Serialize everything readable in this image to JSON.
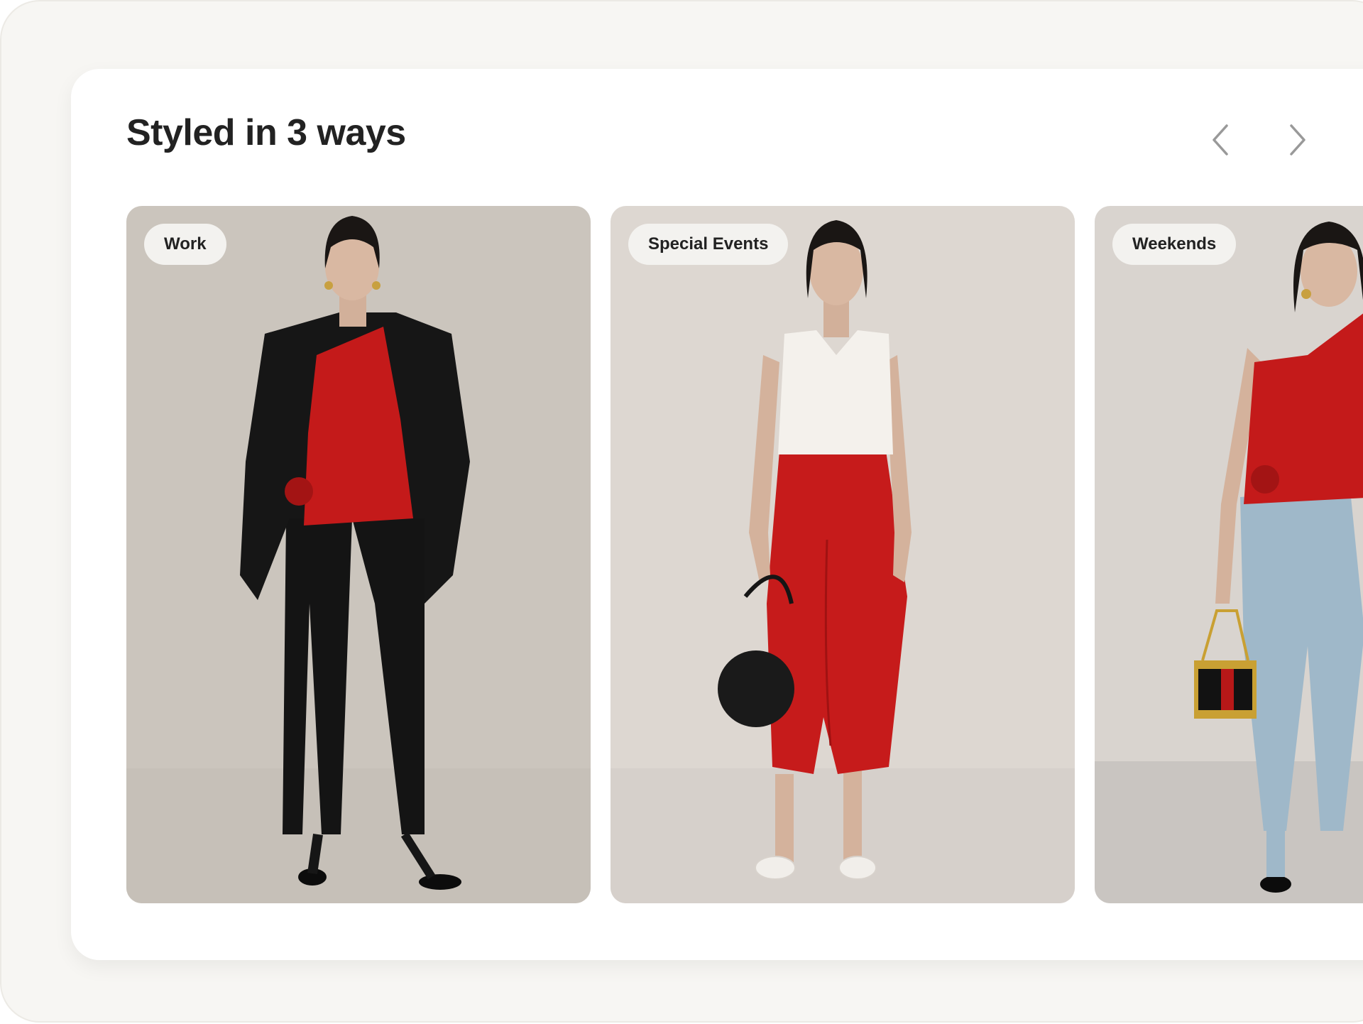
{
  "section": {
    "title": "Styled in 3 ways"
  },
  "nav": {
    "prev_icon": "chevron-left-icon",
    "next_icon": "chevron-right-icon"
  },
  "cards": [
    {
      "tag": "Work",
      "image": "outfit-work-photo"
    },
    {
      "tag": "Special Events",
      "image": "outfit-special-events-photo"
    },
    {
      "tag": "Weekends",
      "image": "outfit-weekends-photo"
    }
  ],
  "colors": {
    "text": "#222222",
    "tag_background": "#f3f2ef",
    "accent_red": "#c41a1a",
    "frame_background": "#f7f6f3"
  }
}
